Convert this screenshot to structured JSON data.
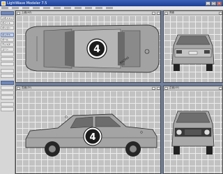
{
  "window": {
    "title": "LightWave Modeler 7.5",
    "controls": [
      "_",
      "□",
      "×"
    ]
  },
  "menubar": [
    "",
    "",
    "",
    "",
    "",
    "",
    "",
    "",
    "",
    "",
    ""
  ],
  "left_panel": {
    "items": [
      {
        "label": "",
        "style": "hdr"
      },
      {
        "label": "ジオメトリ",
        "style": ""
      },
      {
        "label": "ポイント",
        "style": ""
      },
      {
        "label": "ポリゴン",
        "style": ""
      },
      {
        "label": "",
        "style": "gap"
      },
      {
        "label": "ボックス",
        "style": "sel"
      },
      {
        "label": "ボール",
        "style": ""
      },
      {
        "label": "ディスク",
        "style": ""
      },
      {
        "label": "コーン",
        "style": ""
      },
      {
        "label": "",
        "style": ""
      },
      {
        "label": "",
        "style": ""
      },
      {
        "label": "",
        "style": ""
      },
      {
        "label": "",
        "style": "gap"
      },
      {
        "label": "",
        "style": ""
      },
      {
        "label": "",
        "style": ""
      },
      {
        "label": "",
        "style": "gap"
      },
      {
        "label": "",
        "style": "hdr"
      },
      {
        "label": "",
        "style": ""
      },
      {
        "label": "",
        "style": ""
      },
      {
        "label": "",
        "style": ""
      },
      {
        "label": "",
        "style": "gap"
      },
      {
        "label": "",
        "style": ""
      },
      {
        "label": "",
        "style": ""
      }
    ]
  },
  "viewports": {
    "top": {
      "bar_label": "上面(XZ)"
    },
    "back": {
      "bar_label": "背面"
    },
    "side": {
      "bar_label": "右面(ZY)"
    },
    "front": {
      "bar_label": "正面(XY)"
    }
  },
  "car": {
    "race_number": "4",
    "accent": "#1c1c1c",
    "body_color": "#9b9b9b"
  },
  "colors": {
    "titlebar": "#2a4fa6",
    "grid_line": "#ededed",
    "grid_bg": "#c2c2c2",
    "splitter": "#6f7f9e"
  }
}
